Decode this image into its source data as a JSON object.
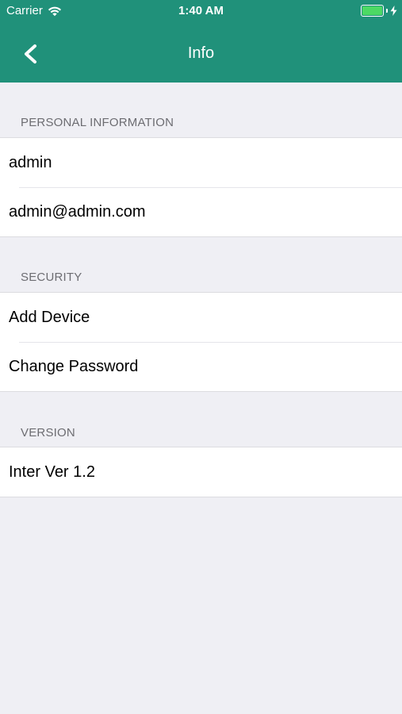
{
  "status_bar": {
    "carrier": "Carrier",
    "time": "1:40 AM",
    "battery_color": "#4cd964"
  },
  "nav": {
    "title": "Info",
    "back_icon": "chevron-left-icon"
  },
  "colors": {
    "header": "#20917a",
    "background": "#efeff4"
  },
  "sections": {
    "personal": {
      "header": "PERSONAL INFORMATION",
      "items": [
        "admin",
        "admin@admin.com"
      ]
    },
    "security": {
      "header": "SECURITY",
      "items": [
        "Add Device",
        "Change Password"
      ]
    },
    "version": {
      "header": "VERSION",
      "items": [
        "Inter Ver 1.2"
      ]
    }
  }
}
